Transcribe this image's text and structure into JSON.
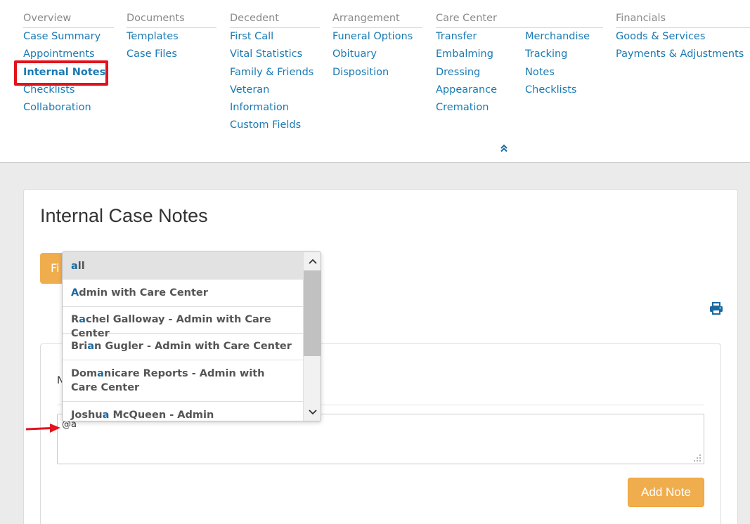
{
  "nav": {
    "overview": {
      "heading": "Overview",
      "links": [
        "Case Summary",
        "Appointments",
        "Internal Notes",
        "Checklists",
        "Collaboration"
      ]
    },
    "documents": {
      "heading": "Documents",
      "links": [
        "Templates",
        "Case Files"
      ]
    },
    "decedent": {
      "heading": "Decedent",
      "links": [
        "First Call",
        "Vital Statistics",
        "Family & Friends",
        "Veteran",
        "Information",
        "Custom Fields"
      ]
    },
    "arrangement": {
      "heading": "Arrangement",
      "links": [
        "Funeral Options",
        "Obituary",
        "Disposition"
      ]
    },
    "care_center": {
      "heading": "Care Center",
      "links_left": [
        "Transfer",
        "Embalming",
        "Dressing",
        "Appearance",
        "Cremation"
      ],
      "links_right": [
        "Merchandise",
        "Tracking",
        "Notes",
        "Checklists"
      ]
    },
    "financials": {
      "heading": "Financials",
      "links": [
        "Goods & Services",
        "Payments & Adjustments"
      ]
    }
  },
  "page": {
    "title": "Internal Case Notes",
    "filter_button_label": "Fi",
    "inner_label": "N",
    "textarea_value": "@a",
    "add_note_label": "Add Note"
  },
  "mention_dropdown": {
    "items": [
      {
        "pre": "",
        "hi": "a",
        "post": "ll"
      },
      {
        "pre": "",
        "hi": "A",
        "post": "dmin with Care Center"
      },
      {
        "pre": "R",
        "hi": "a",
        "post": "chel Galloway - Admin with Care Center"
      },
      {
        "pre": "Bri",
        "hi": "a",
        "post": "n Gugler - Admin with Care Center"
      },
      {
        "pre": "Dom",
        "hi": "a",
        "post": "nicare Reports - Admin with Care Center"
      },
      {
        "pre": "Joshu",
        "hi": "a",
        "post": " McQueen - Admin"
      }
    ]
  },
  "colors": {
    "link": "#1a7ab3",
    "accent_orange": "#f0ad4e",
    "highlight_red": "#e3121b"
  }
}
